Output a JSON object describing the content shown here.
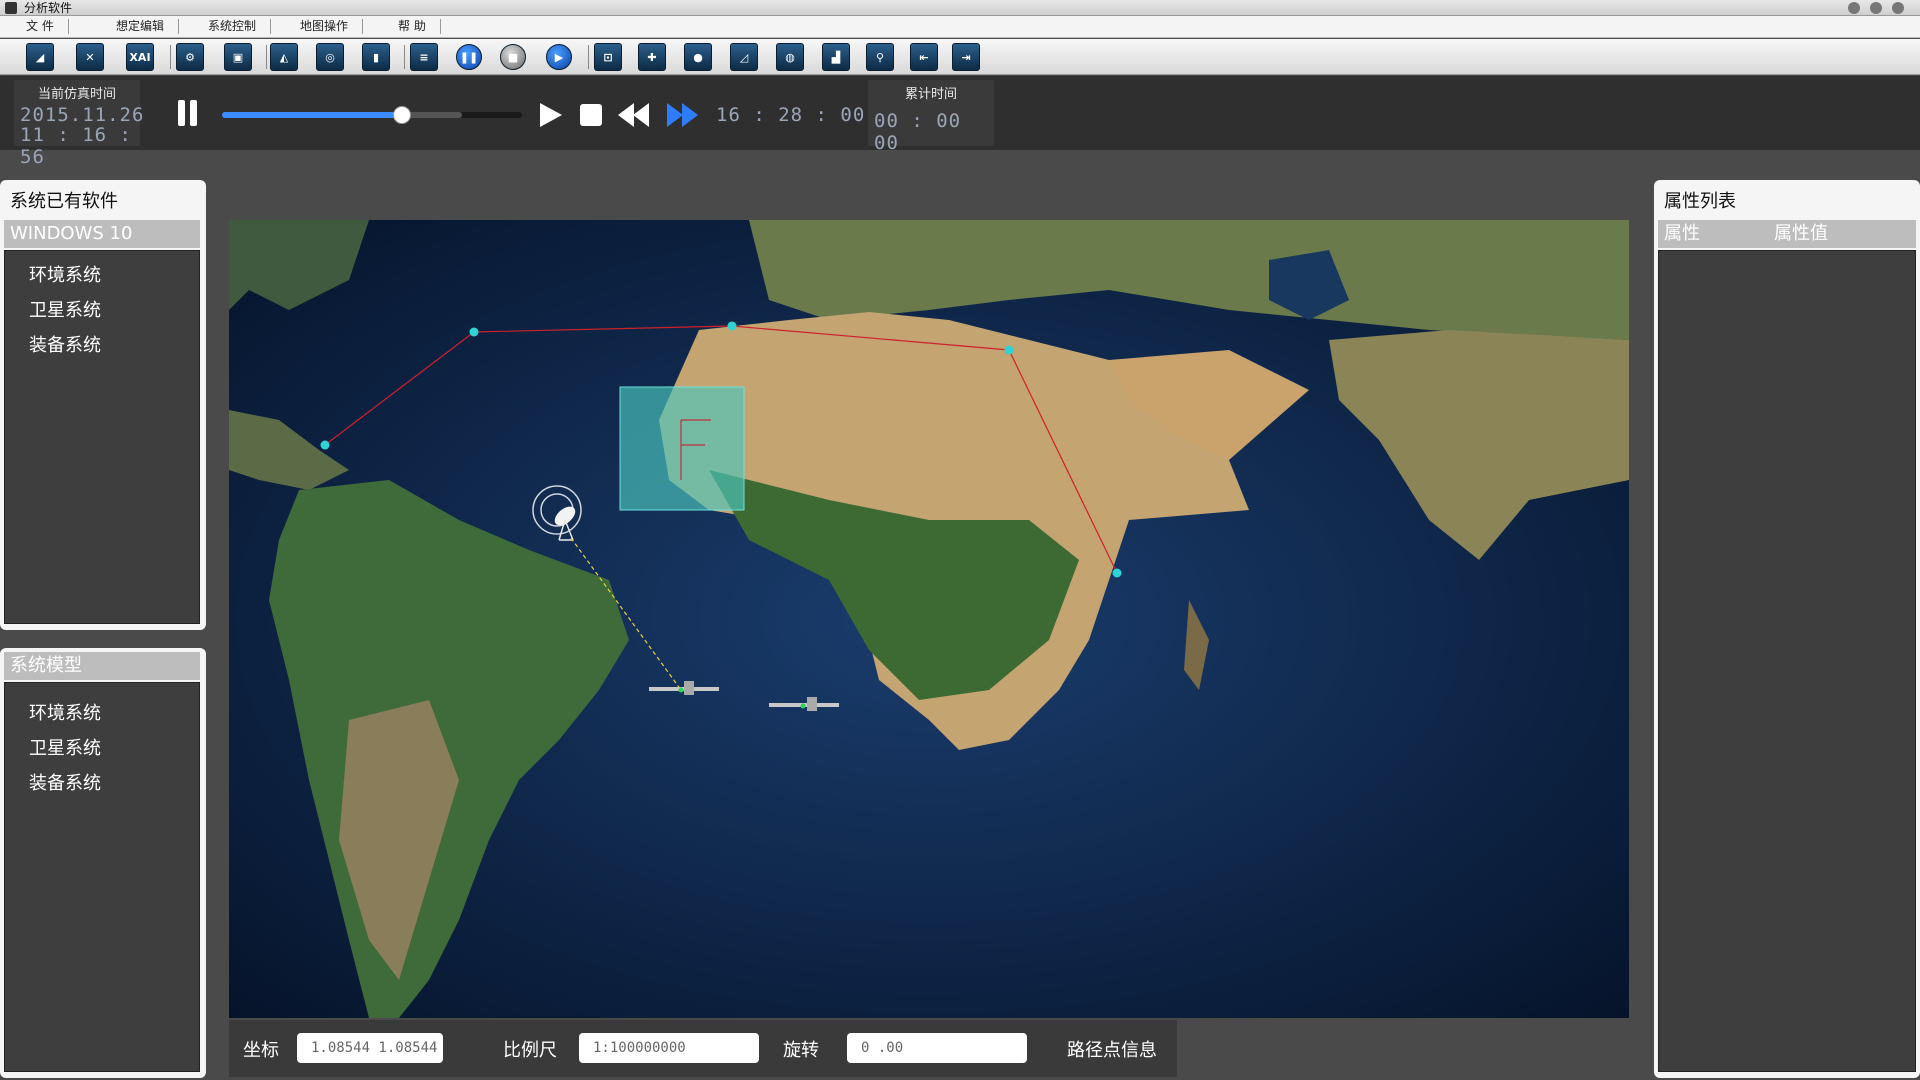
{
  "window": {
    "title": "分析软件"
  },
  "menu": [
    "文  件",
    "想定编辑",
    "系统控制",
    "地图操作",
    "帮  助"
  ],
  "toolbar_icons": [
    "layer-icon",
    "cross-icon",
    "xai-icon",
    "settings-icon",
    "frame-icon",
    "shape-icon",
    "ring-icon",
    "page-icon",
    "doc-icon",
    "pause-icon",
    "stop-icon",
    "play-icon",
    "select-icon",
    "plus-icon",
    "globe-icon",
    "corner-icon",
    "earth-icon",
    "chart-icon",
    "zoom-icon",
    "back-icon",
    "forward-icon"
  ],
  "playback": {
    "current_time_label": "当前仿真时间",
    "current_date": "2015.11.26",
    "current_time": "11 : 16 : 56",
    "progress": 0.6,
    "clock": "16 : 28 : 00",
    "elapsed_label": "累计时间",
    "elapsed": "00 : 00 00"
  },
  "left_panel": {
    "title": "系统已有软件",
    "header": "WINDOWS  10",
    "items": [
      "环境系统",
      "卫星系统",
      "装备系统"
    ]
  },
  "model_panel": {
    "header": "系统模型",
    "items": [
      "环境系统",
      "卫星系统",
      "装备系统"
    ]
  },
  "right_panel": {
    "title": "属性列表",
    "col1": "属性",
    "col2": "属性值"
  },
  "status": {
    "coord_label": "坐标",
    "coord_value": "1.08544  1.08544",
    "scale_label": "比例尺",
    "scale_value": "1:100000000",
    "rotate_label": "旋转",
    "rotate_value": "0  .00",
    "route_label": "路径点信息"
  },
  "colors": {
    "accent": "#3d8cff",
    "route": "#d0202a",
    "waypoint": "#2ed3d3",
    "link": "#e6d23a"
  }
}
